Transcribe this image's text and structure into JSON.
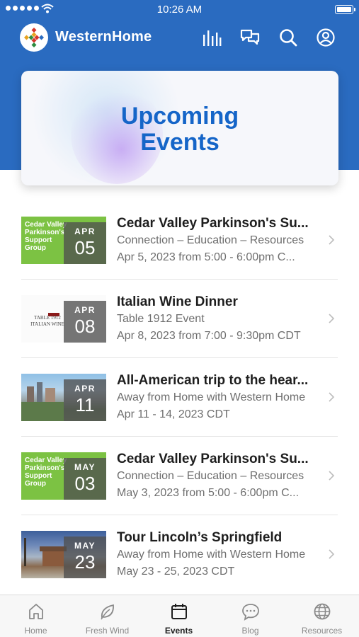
{
  "status_bar": {
    "time": "10:26 AM"
  },
  "app": {
    "title": "WesternHome"
  },
  "actions": [
    "chart-icon",
    "chat-icon",
    "search-icon",
    "account-icon"
  ],
  "hero": {
    "line1": "Upcoming",
    "line2": "Events"
  },
  "events": [
    {
      "thumb_text": "Cedar Valley Parkinson's Support Group",
      "month": "APR",
      "day": "05",
      "title": "Cedar Valley Parkinson's Su...",
      "subtitle": "Connection – Education – Resources",
      "date": "Apr 5, 2023 from 5:00 - 6:00pm C..."
    },
    {
      "thumb_text": "TABLE 1912 ITALIAN WINE",
      "month": "APR",
      "day": "08",
      "title": "Italian Wine Dinner",
      "subtitle": "Table 1912 Event",
      "date": "Apr 8, 2023 from 7:00 - 9:30pm CDT"
    },
    {
      "thumb_text": "",
      "month": "APR",
      "day": "11",
      "title": "All-American trip to the hear...",
      "subtitle": "Away from Home with Western Home",
      "date": "Apr 11 - 14, 2023 CDT"
    },
    {
      "thumb_text": "Cedar Valley Parkinson's Support Group",
      "month": "MAY",
      "day": "03",
      "title": "Cedar Valley Parkinson's Su...",
      "subtitle": "Connection – Education – Resources",
      "date": "May 3, 2023 from 5:00 - 6:00pm C..."
    },
    {
      "thumb_text": "",
      "month": "MAY",
      "day": "23",
      "title": "Tour Lincoln’s Springfield",
      "subtitle": "Away from Home with Western Home",
      "date": "May 23 - 25, 2023 CDT"
    }
  ],
  "tabs": [
    {
      "label": "Home",
      "icon": "home-icon"
    },
    {
      "label": "Fresh Wind",
      "icon": "leaf-icon"
    },
    {
      "label": "Events",
      "icon": "calendar-icon"
    },
    {
      "label": "Blog",
      "icon": "chat-bubble-icon"
    },
    {
      "label": "Resources",
      "icon": "globe-icon"
    }
  ],
  "colors": {
    "header": "#2a6bc0",
    "hero_text": "#1565c8",
    "green_thumb": "#7cc243"
  }
}
